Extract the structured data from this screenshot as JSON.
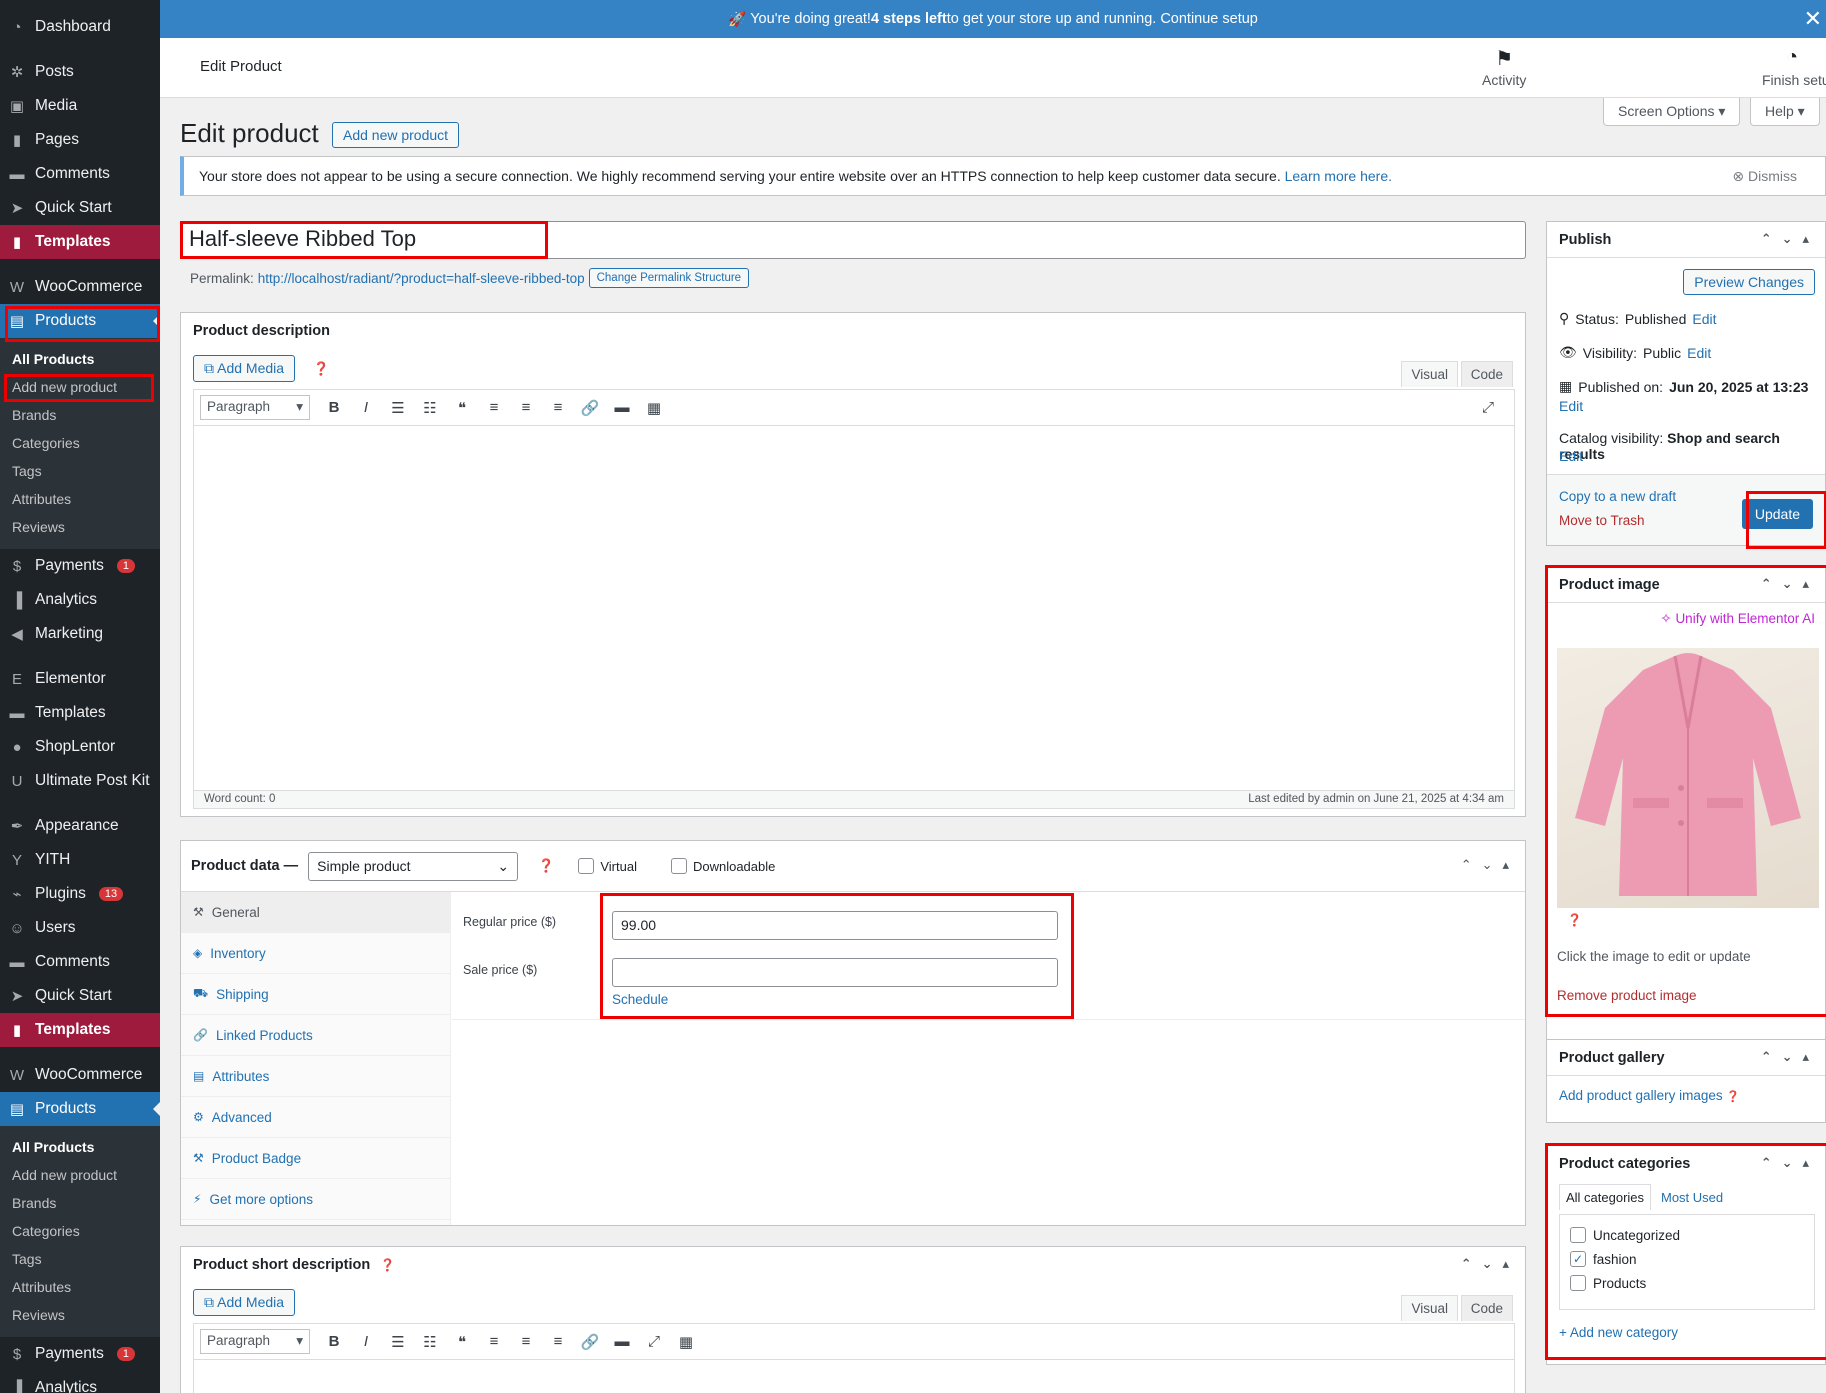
{
  "sidebar": {
    "items": [
      {
        "label": "Dashboard",
        "icon": "dashboard-icon",
        "glyph": "◔"
      },
      {
        "label": "Posts",
        "icon": "pin-icon",
        "glyph": "✲"
      },
      {
        "label": "Media",
        "icon": "media-icon",
        "glyph": "▣"
      },
      {
        "label": "Pages",
        "icon": "pages-icon",
        "glyph": "▮"
      },
      {
        "label": "Comments",
        "icon": "comment-icon",
        "glyph": "▬"
      },
      {
        "label": "Quick Start",
        "icon": "rocket-icon",
        "glyph": "➤"
      },
      {
        "label": "Templates",
        "icon": "templates-icon",
        "glyph": "▮"
      },
      {
        "label": "WooCommerce",
        "icon": "woo-icon",
        "glyph": "W"
      },
      {
        "label": "Products",
        "icon": "products-icon",
        "glyph": "▤"
      }
    ],
    "sub1": [
      "All Products",
      "Add new product",
      "Brands",
      "Categories",
      "Tags",
      "Attributes",
      "Reviews"
    ],
    "items2": [
      {
        "label": "Payments",
        "badge": "1",
        "icon": "payments-icon",
        "glyph": "$"
      },
      {
        "label": "Analytics",
        "icon": "analytics-icon",
        "glyph": "▐"
      },
      {
        "label": "Marketing",
        "icon": "megaphone-icon",
        "glyph": "◀"
      },
      {
        "label": "Elementor",
        "icon": "elementor-icon",
        "glyph": "E"
      },
      {
        "label": "Templates",
        "icon": "folder-icon",
        "glyph": "▬"
      },
      {
        "label": "ShopLentor",
        "icon": "shoplentor-icon",
        "glyph": "●"
      },
      {
        "label": "Ultimate Post Kit",
        "icon": "upk-icon",
        "glyph": "U"
      },
      {
        "label": "Appearance",
        "icon": "brush-icon",
        "glyph": "✒"
      },
      {
        "label": "YITH",
        "icon": "yith-icon",
        "glyph": "Y"
      },
      {
        "label": "Plugins",
        "badge": "13",
        "icon": "plug-icon",
        "glyph": "⌁"
      },
      {
        "label": "Users",
        "icon": "users-icon",
        "glyph": "☺"
      },
      {
        "label": "Comments",
        "icon": "comment-icon",
        "glyph": "▬"
      },
      {
        "label": "Quick Start",
        "icon": "rocket-icon",
        "glyph": "➤"
      },
      {
        "label": "Templates",
        "icon": "templates-icon",
        "glyph": "▮"
      },
      {
        "label": "WooCommerce",
        "icon": "woo-icon",
        "glyph": "W"
      },
      {
        "label": "Products",
        "icon": "products-icon",
        "glyph": "▤"
      }
    ],
    "sub2": [
      "All Products",
      "Add new product",
      "Brands",
      "Categories",
      "Tags",
      "Attributes",
      "Reviews"
    ],
    "items3": [
      {
        "label": "Payments",
        "badge": "1",
        "icon": "payments-icon",
        "glyph": "$"
      },
      {
        "label": "Analytics",
        "icon": "analytics-icon",
        "glyph": "▐"
      }
    ]
  },
  "banner": {
    "emoji": "🚀",
    "pre": "You're doing great! ",
    "bold": "4 steps left",
    "post": " to get your store up and running.",
    "link": "Continue setup",
    "close": "✕"
  },
  "header": {
    "title": "Edit Product",
    "activity": "Activity",
    "finish": "Finish setu"
  },
  "page": {
    "title": "Edit product",
    "add_new": "Add new product",
    "screen_options": "Screen Options ▾",
    "help": "Help ▾"
  },
  "notice": {
    "text": "Your store does not appear to be using a secure connection. We highly recommend serving your entire website over an HTTPS connection to help keep customer data secure.",
    "link": "Learn more here.",
    "dismiss": "Dismiss"
  },
  "product": {
    "title": "Half-sleeve Ribbed Top",
    "permalink_label": "Permalink:",
    "permalink": "http://localhost/radiant/?product=half-sleeve-ribbed-top",
    "change_permalink": "Change Permalink Structure"
  },
  "description": {
    "header": "Product description",
    "add_media": "Add Media",
    "tab_visual": "Visual",
    "tab_code": "Code",
    "format": "Paragraph",
    "word_count": "Word count: 0",
    "last_edited": "Last edited by admin on June 21, 2025 at 4:34 am"
  },
  "product_data": {
    "label": "Product data —",
    "type": "Simple product",
    "virtual": "Virtual",
    "downloadable": "Downloadable",
    "tabs": [
      "General",
      "Inventory",
      "Shipping",
      "Linked Products",
      "Attributes",
      "Advanced",
      "Product Badge",
      "Get more options"
    ],
    "regular_label": "Regular price ($)",
    "regular_value": "99.00",
    "sale_label": "Sale price ($)",
    "sale_value": "",
    "schedule": "Schedule"
  },
  "short_desc": {
    "header": "Product short description",
    "add_media": "Add Media",
    "tab_visual": "Visual",
    "tab_code": "Code",
    "format": "Paragraph"
  },
  "publish": {
    "header": "Publish",
    "preview": "Preview Changes",
    "status": "Status: ",
    "status_val": "Published",
    "visibility": "Visibility: ",
    "visibility_val": "Public",
    "published_on": "Published on: ",
    "published_date": "Jun 20, 2025 at 13:23",
    "catalog": "Catalog visibility: ",
    "catalog_val": "Shop and search results",
    "edit": "Edit",
    "copy_draft": "Copy to a new draft",
    "trash": "Move to Trash",
    "update": "Update"
  },
  "image": {
    "header": "Product image",
    "unify": "Unify with Elementor AI",
    "hint": "Click the image to edit or update",
    "remove": "Remove product image"
  },
  "gallery": {
    "header": "Product gallery",
    "add": "Add product gallery images"
  },
  "categories": {
    "header": "Product categories",
    "tab_all": "All categories",
    "tab_most": "Most Used",
    "items": [
      {
        "label": "Uncategorized",
        "checked": false
      },
      {
        "label": "fashion",
        "checked": true
      },
      {
        "label": "Products",
        "checked": false
      }
    ],
    "add": "+ Add new category"
  },
  "colors": {
    "sidebar": "#1d2327",
    "accent": "#2271b1",
    "banner": "#3582c4",
    "highlight": "#e00000",
    "templates": "#9e1b3d"
  }
}
